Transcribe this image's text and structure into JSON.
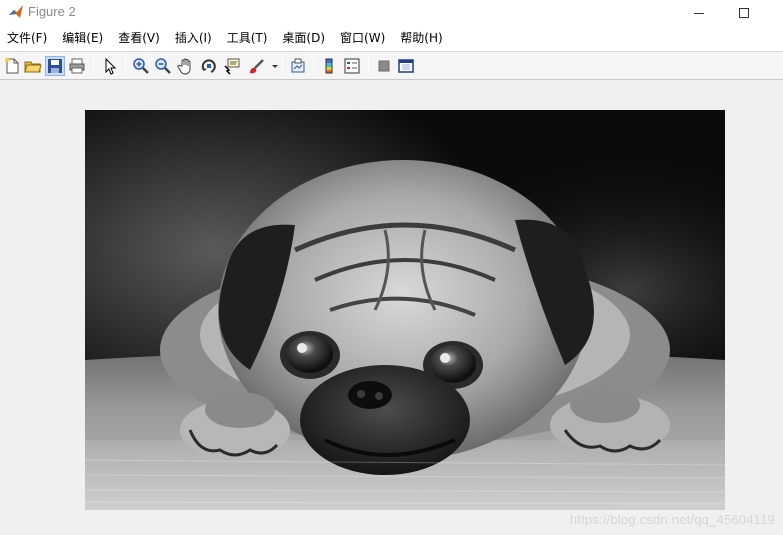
{
  "window": {
    "title": "Figure 2",
    "app_icon": "matlab-icon"
  },
  "menu": {
    "items": [
      {
        "label": "文件(F)"
      },
      {
        "label": "编辑(E)"
      },
      {
        "label": "查看(V)"
      },
      {
        "label": "插入(I)"
      },
      {
        "label": "工具(T)"
      },
      {
        "label": "桌面(D)"
      },
      {
        "label": "窗口(W)"
      },
      {
        "label": "帮助(H)"
      }
    ]
  },
  "toolbar": {
    "buttons": [
      {
        "icon": "new-figure-icon"
      },
      {
        "icon": "open-folder-icon"
      },
      {
        "icon": "save-icon"
      },
      {
        "icon": "print-icon"
      },
      {
        "icon": "pointer-icon"
      },
      {
        "icon": "zoom-in-icon"
      },
      {
        "icon": "zoom-out-icon"
      },
      {
        "icon": "pan-hand-icon"
      },
      {
        "icon": "rotate-3d-icon"
      },
      {
        "icon": "data-cursor-icon"
      },
      {
        "icon": "brush-icon"
      },
      {
        "icon": "link-plot-icon"
      },
      {
        "icon": "colorbar-icon"
      },
      {
        "icon": "legend-icon"
      },
      {
        "icon": "hide-plot-tools-icon"
      },
      {
        "icon": "show-plot-tools-icon"
      }
    ]
  },
  "figure": {
    "image": "pug-grayscale-photo",
    "watermark": "https://blog.csdn.net/qq_45604119"
  }
}
